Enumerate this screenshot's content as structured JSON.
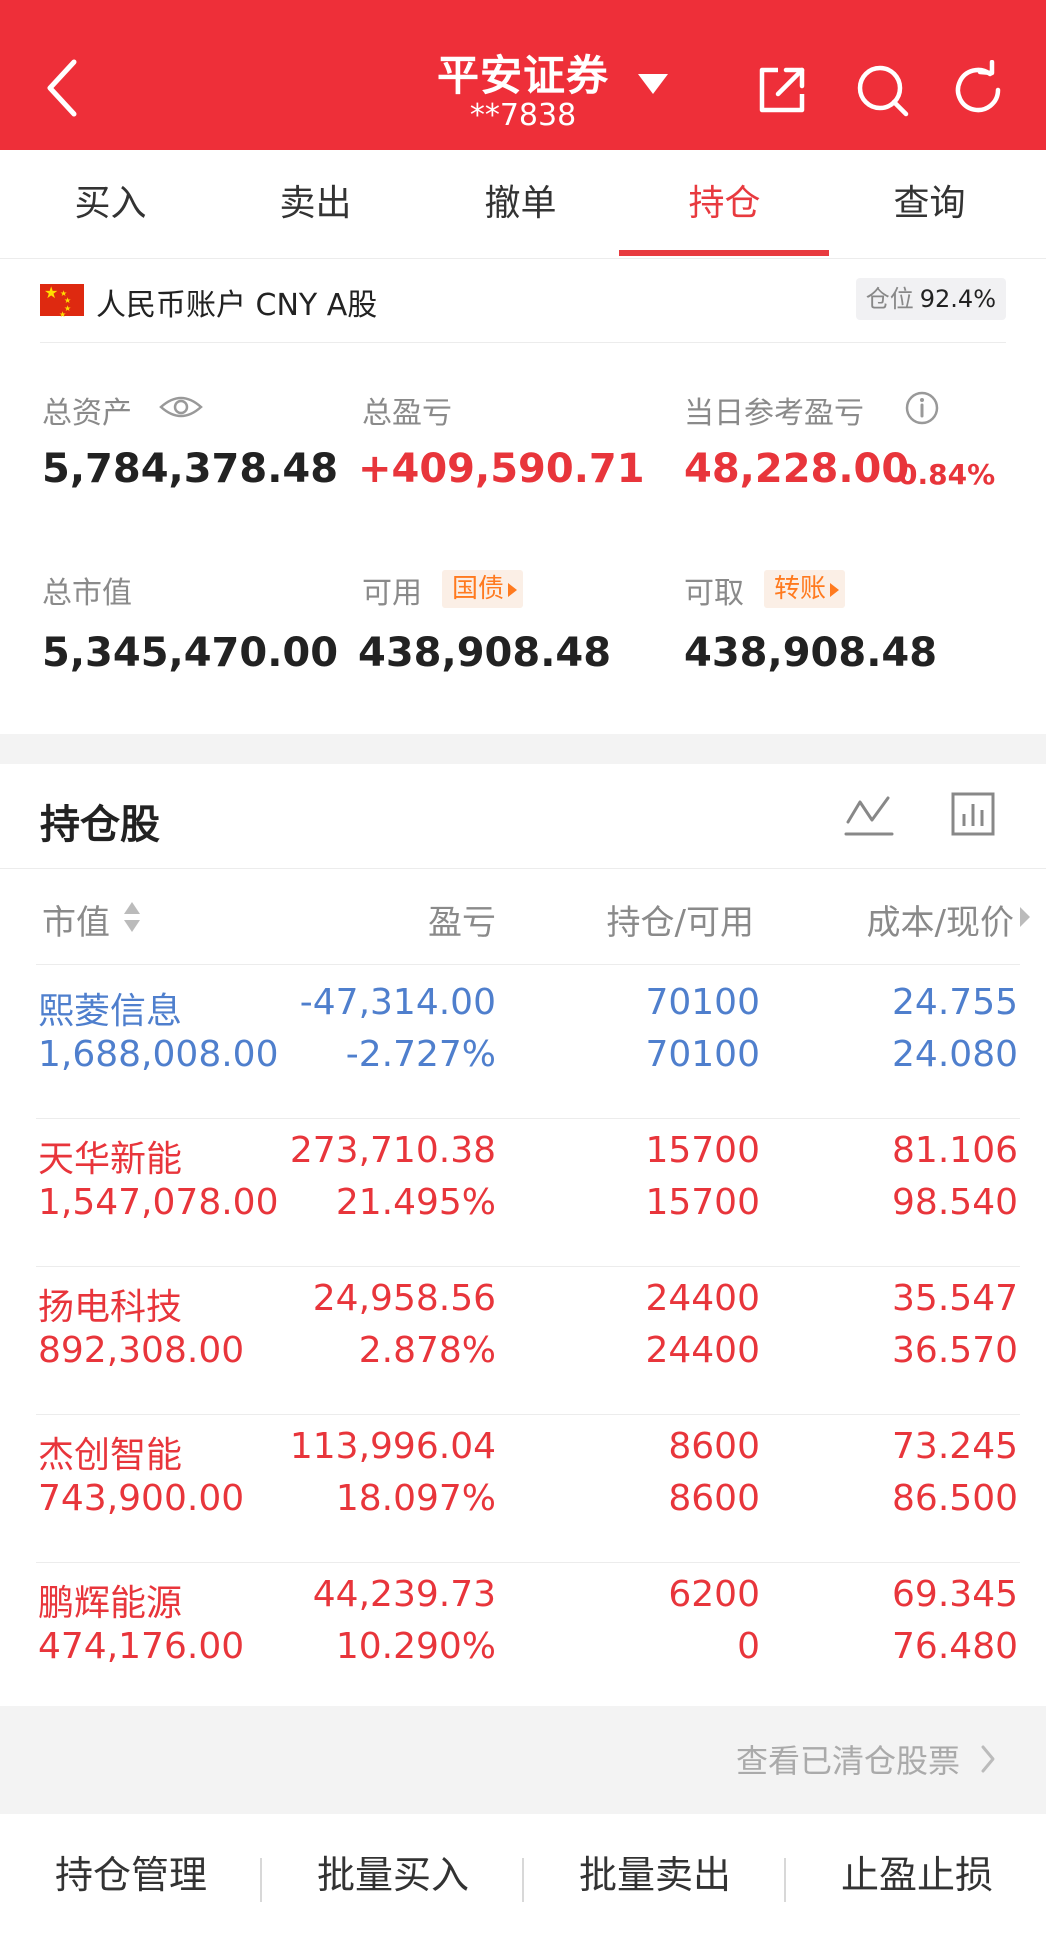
{
  "header": {
    "title": "平安证券",
    "account_masked": "**7838"
  },
  "tabs": [
    {
      "label": "买入",
      "active": false
    },
    {
      "label": "卖出",
      "active": false
    },
    {
      "label": "撤单",
      "active": false
    },
    {
      "label": "持仓",
      "active": true
    },
    {
      "label": "查询",
      "active": false
    }
  ],
  "account": {
    "label": "人民币账户 CNY A股",
    "position_label": "仓位",
    "position_value": "92.4%"
  },
  "summary": {
    "total_assets_label": "总资产",
    "total_assets": "5,784,378.48",
    "total_pl_label": "总盈亏",
    "total_pl": "+409,590.71",
    "daily_pl_label": "当日参考盈亏",
    "daily_pl": "48,228.00",
    "daily_pl_pct": "0.84%",
    "market_value_label": "总市值",
    "market_value": "5,345,470.00",
    "available_label": "可用",
    "available_tag": "国债",
    "available": "438,908.48",
    "withdrawable_label": "可取",
    "withdrawable_tag": "转账",
    "withdrawable": "438,908.48"
  },
  "holdings": {
    "title": "持仓股",
    "columns": {
      "market_value": "市值",
      "pl": "盈亏",
      "position": "持仓/可用",
      "cost_price": "成本/现价"
    },
    "rows": [
      {
        "name": "熙菱信息",
        "market_value": "1,688,008.00",
        "pl": "-47,314.00",
        "pl_pct": "-2.727%",
        "position": "70100",
        "available": "70100",
        "cost": "24.755",
        "price": "24.080",
        "color": "#4f7fcd"
      },
      {
        "name": "天华新能",
        "market_value": "1,547,078.00",
        "pl": "273,710.38",
        "pl_pct": "21.495%",
        "position": "15700",
        "available": "15700",
        "cost": "81.106",
        "price": "98.540",
        "color": "#e8353b"
      },
      {
        "name": "扬电科技",
        "market_value": "892,308.00",
        "pl": "24,958.56",
        "pl_pct": "2.878%",
        "position": "24400",
        "available": "24400",
        "cost": "35.547",
        "price": "36.570",
        "color": "#e8353b"
      },
      {
        "name": "杰创智能",
        "market_value": "743,900.00",
        "pl": "113,996.04",
        "pl_pct": "18.097%",
        "position": "8600",
        "available": "8600",
        "cost": "73.245",
        "price": "86.500",
        "color": "#e8353b"
      },
      {
        "name": "鹏辉能源",
        "market_value": "474,176.00",
        "pl": "44,239.73",
        "pl_pct": "10.290%",
        "position": "6200",
        "available": "0",
        "cost": "69.345",
        "price": "76.480",
        "color": "#e8353b"
      }
    ]
  },
  "footer": {
    "view_cleared": "查看已清仓股票",
    "actions": [
      "持仓管理",
      "批量买入",
      "批量卖出",
      "止盈止损"
    ]
  },
  "colors": {
    "brand_red": "#ee2f39",
    "gain": "#e8353b",
    "loss": "#4f7fcd",
    "tag_orange": "#ff7a1f"
  }
}
